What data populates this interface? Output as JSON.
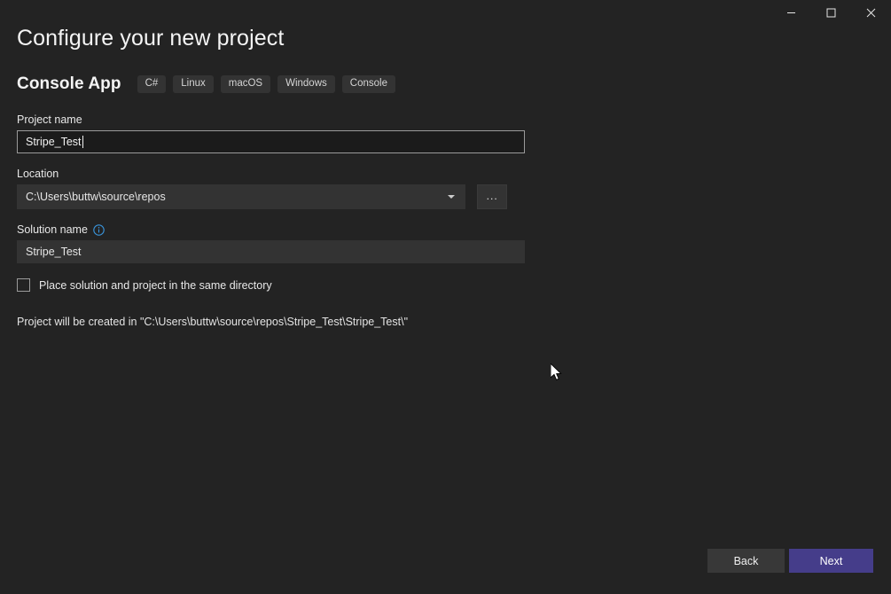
{
  "window": {
    "controls": [
      {
        "name": "minimize",
        "label": "—"
      },
      {
        "name": "maximize",
        "label": "□"
      },
      {
        "name": "close",
        "label": "✕"
      }
    ]
  },
  "header": {
    "title": "Configure your new project",
    "app_type": "Console App",
    "tags": [
      "C#",
      "Linux",
      "macOS",
      "Windows",
      "Console"
    ]
  },
  "form": {
    "project_name": {
      "label": "Project name",
      "value": "Stripe_Test",
      "placeholder": ""
    },
    "location": {
      "label": "Location",
      "value": "C:\\Users\\buttw\\source\\repos",
      "browse_label": "...",
      "dropdown_icon": "chevron-down-icon"
    },
    "solution_name": {
      "label": "Solution name",
      "info_icon": "info-icon",
      "value": "Stripe_Test"
    },
    "same_directory_checkbox": {
      "label": "Place solution and project in the same directory",
      "checked": false
    },
    "created_note": "Project will be created in \"C:\\Users\\buttw\\source\\repos\\Stripe_Test\\Stripe_Test\\\""
  },
  "footer": {
    "back_label": "Back",
    "next_label": "Next"
  },
  "colors": {
    "background": "#232323",
    "accent": "#453d8a",
    "field_border": "#9a9a9a",
    "chip_background": "#333333",
    "info_icon": "#3a96dd"
  }
}
